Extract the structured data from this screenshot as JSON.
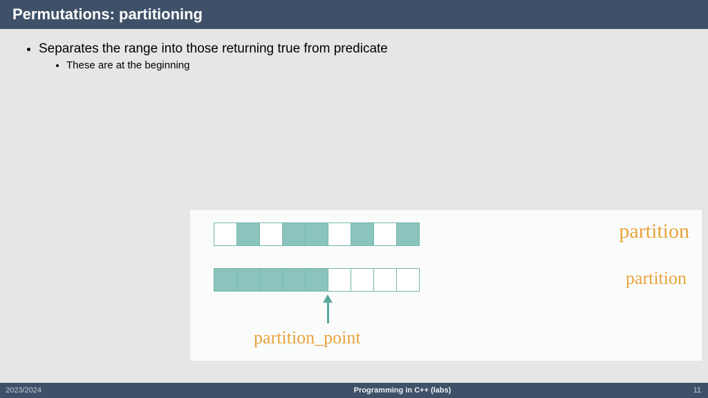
{
  "title": "Permutations: partitioning",
  "bullets": {
    "b1": "Separates the range into those returning true from predicate",
    "b1_1": "These are at the beginning"
  },
  "diagram": {
    "row1": [
      0,
      1,
      0,
      1,
      1,
      0,
      1,
      0,
      1
    ],
    "row2": [
      1,
      1,
      1,
      1,
      1,
      0,
      0,
      0,
      0
    ],
    "label_top": "partition",
    "label_bottom": "partition",
    "label_arrow": "partition_point"
  },
  "footer": {
    "year": "2023/2024",
    "course": "Programming in C++ (labs)",
    "page": "11"
  }
}
